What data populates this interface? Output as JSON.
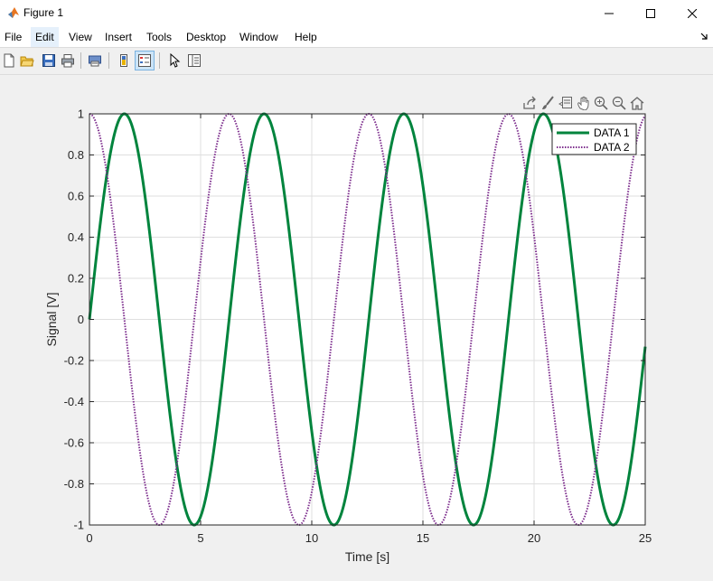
{
  "window": {
    "title": "Figure 1"
  },
  "menu": [
    "File",
    "Edit",
    "View",
    "Insert",
    "Tools",
    "Desktop",
    "Window",
    "Help"
  ],
  "menu_active": "Edit",
  "toolbar_icons": [
    "new-figure-icon",
    "open-file-icon",
    "save-icon",
    "print-icon",
    "print-preview-icon",
    "colorbar-icon",
    "legend-icon",
    "edit-plot-arrow-icon",
    "property-inspector-icon"
  ],
  "axes_toolbar_icons": [
    "export-icon",
    "brush-icon",
    "datatip-icon",
    "pan-icon",
    "zoom-in-icon",
    "zoom-out-icon",
    "home-icon"
  ],
  "chart_data": {
    "type": "line",
    "xlabel": "Time [s]",
    "ylabel": "Signal [V]",
    "xlim": [
      0,
      25
    ],
    "ylim": [
      -1,
      1
    ],
    "xticks": [
      0,
      5,
      10,
      15,
      20,
      25
    ],
    "yticks": [
      -1,
      -0.8,
      -0.6,
      -0.4,
      -0.2,
      0,
      0.2,
      0.4,
      0.6,
      0.8,
      1
    ],
    "grid": true,
    "legend_position": "top-right",
    "series": [
      {
        "name": "DATA 1",
        "function": "sin(t)",
        "t_range": [
          0,
          25
        ],
        "style": "solid",
        "color": "#00843d"
      },
      {
        "name": "DATA 2",
        "function": "cos(t)",
        "t_range": [
          0,
          25
        ],
        "style": "dotted",
        "color": "#7e2f8e"
      }
    ]
  }
}
